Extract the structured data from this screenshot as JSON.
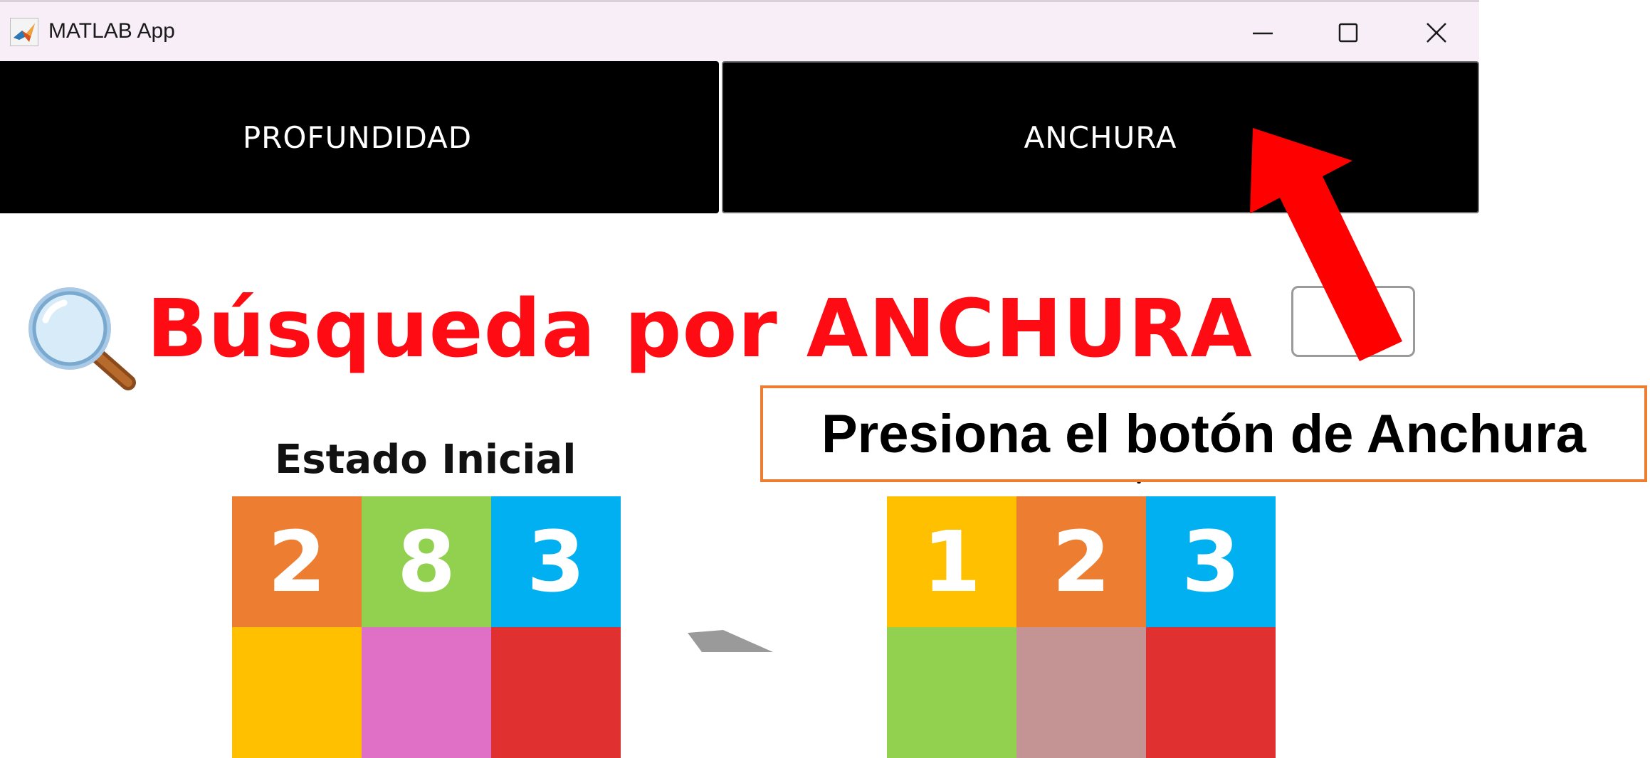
{
  "window": {
    "title": "MATLAB App",
    "icons": {
      "app": "matlab-logo-icon",
      "minimize": "minimize-icon",
      "maximize": "maximize-icon",
      "close": "close-icon"
    }
  },
  "toolbar": {
    "profundidad_label": "PROFUNDIDAD",
    "anchura_label": "ANCHURA"
  },
  "main": {
    "heading": "Búsqueda por ANCHURA",
    "heading_icon": "magnifying-glass-icon",
    "initial_state": {
      "label": "Estado Inicial",
      "row1": [
        "2",
        "8",
        "3"
      ],
      "row1_colors": [
        "#ed7d31",
        "#92d050",
        "#00b0f0"
      ],
      "row2_colors": [
        "#ffc000",
        "#e06fc6",
        "#e03030"
      ]
    },
    "goal_state": {
      "row1": [
        "1",
        "2",
        "3"
      ],
      "row1_colors": [
        "#ffc000",
        "#ed7d31",
        "#00b0f0"
      ],
      "row2_colors": [
        "#92d050",
        "#c49494",
        "#e03030"
      ]
    }
  },
  "annotation": {
    "callout_text": "Presiona el botón de Anchura",
    "arrow_color": "#ff0000",
    "border_color": "#ed7d31"
  }
}
